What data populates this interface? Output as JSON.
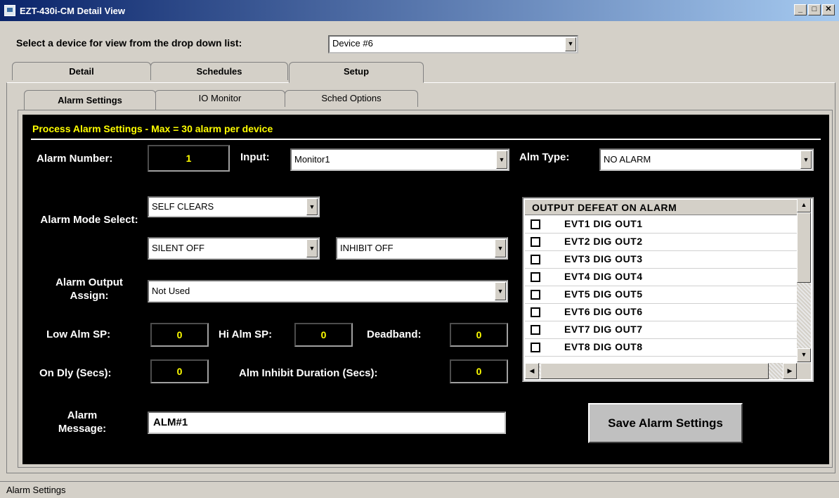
{
  "window": {
    "title": "EZT-430i-CM Detail View"
  },
  "device_selector": {
    "label": "Select a device for view from the drop down list:",
    "value": "Device #6"
  },
  "main_tabs": [
    {
      "label": "Detail"
    },
    {
      "label": "Schedules"
    },
    {
      "label": "Setup"
    }
  ],
  "sub_tabs": [
    {
      "label": "Alarm Settings"
    },
    {
      "label": "IO Monitor"
    },
    {
      "label": "Sched Options"
    }
  ],
  "panel": {
    "header": "Process Alarm Settings - Max = 30 alarm per device",
    "alarm_number": {
      "label": "Alarm Number:",
      "value": "1"
    },
    "input": {
      "label": "Input:",
      "value": "Monitor1"
    },
    "alm_type": {
      "label": "Alm Type:",
      "value": "NO ALARM"
    },
    "alarm_mode": {
      "label": "Alarm Mode Select:",
      "mode_value": "SELF CLEARS",
      "silent_value": "SILENT OFF",
      "inhibit_value": "INHIBIT OFF"
    },
    "output_assign": {
      "label": "Alarm Output Assign:",
      "value": "Not Used"
    },
    "low_sp": {
      "label": "Low Alm SP:",
      "value": "0"
    },
    "hi_sp": {
      "label": "Hi Alm SP:",
      "value": "0"
    },
    "deadband": {
      "label": "Deadband:",
      "value": "0"
    },
    "on_dly": {
      "label": "On Dly (Secs):",
      "value": "0"
    },
    "inhibit_duration": {
      "label": "Alm Inhibit Duration (Secs):",
      "value": "0"
    },
    "message": {
      "label": "Alarm Message:",
      "value": "ALM#1"
    },
    "save_button": "Save Alarm Settings"
  },
  "output_defeat": {
    "header": "OUTPUT DEFEAT ON ALARM",
    "items": [
      {
        "label": "EVT1 DIG OUT1",
        "checked": false
      },
      {
        "label": "EVT2 DIG OUT2",
        "checked": false
      },
      {
        "label": "EVT3 DIG OUT3",
        "checked": false
      },
      {
        "label": "EVT4 DIG OUT4",
        "checked": false
      },
      {
        "label": "EVT5 DIG OUT5",
        "checked": false
      },
      {
        "label": "EVT6 DIG OUT6",
        "checked": false
      },
      {
        "label": "EVT7 DIG OUT7",
        "checked": false
      },
      {
        "label": "EVT8 DIG OUT8",
        "checked": false
      }
    ]
  },
  "status_bar": {
    "text": "Alarm Settings"
  },
  "colors": {
    "title_start": "#0a246a",
    "title_end": "#a6caf0",
    "panel_bg": "#000000",
    "accent_yellow": "#ffff00",
    "face": "#d4d0c8"
  }
}
